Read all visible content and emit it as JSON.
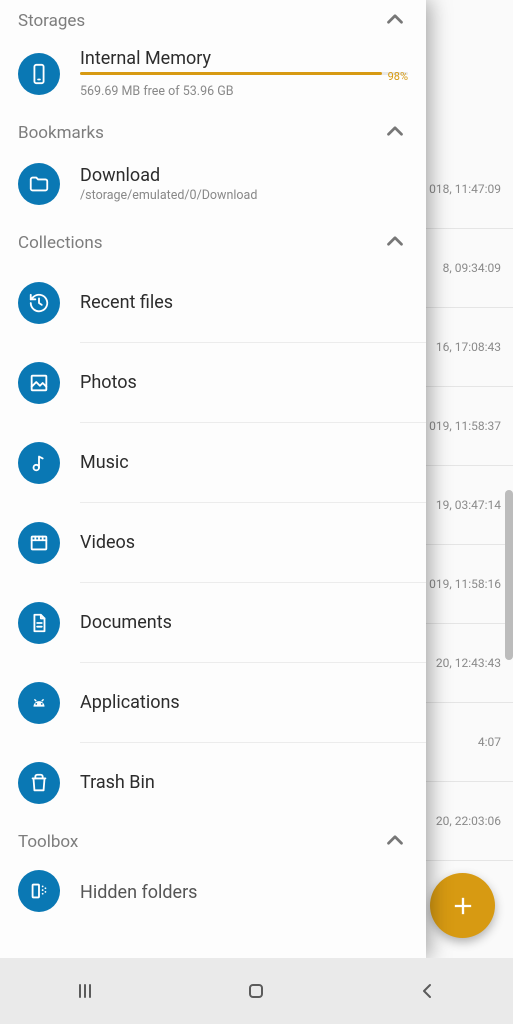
{
  "sections": {
    "storages": {
      "label": "Storages"
    },
    "bookmarks": {
      "label": "Bookmarks"
    },
    "collections": {
      "label": "Collections"
    },
    "toolbox": {
      "label": "Toolbox"
    }
  },
  "storage": {
    "title": "Internal Memory",
    "subtitle": "569.69 MB free of 53.96 GB",
    "percent_label": "98%",
    "percent_value": 98
  },
  "bookmark": {
    "title": "Download",
    "path": "/storage/emulated/0/Download"
  },
  "collections": [
    {
      "label": "Recent files",
      "icon": "history"
    },
    {
      "label": "Photos",
      "icon": "image"
    },
    {
      "label": "Music",
      "icon": "music"
    },
    {
      "label": "Videos",
      "icon": "video"
    },
    {
      "label": "Documents",
      "icon": "document"
    },
    {
      "label": "Applications",
      "icon": "android"
    },
    {
      "label": "Trash Bin",
      "icon": "trash"
    }
  ],
  "toolbox": [
    {
      "label": "Hidden folders",
      "icon": "hidden"
    }
  ],
  "background_rows": [
    "018, 11:47:09",
    "8, 09:34:09",
    "16, 17:08:43",
    "019, 11:58:37",
    "19, 03:47:14",
    "019, 11:58:16",
    "20, 12:43:43",
    "4:07",
    "20, 22:03:06"
  ]
}
